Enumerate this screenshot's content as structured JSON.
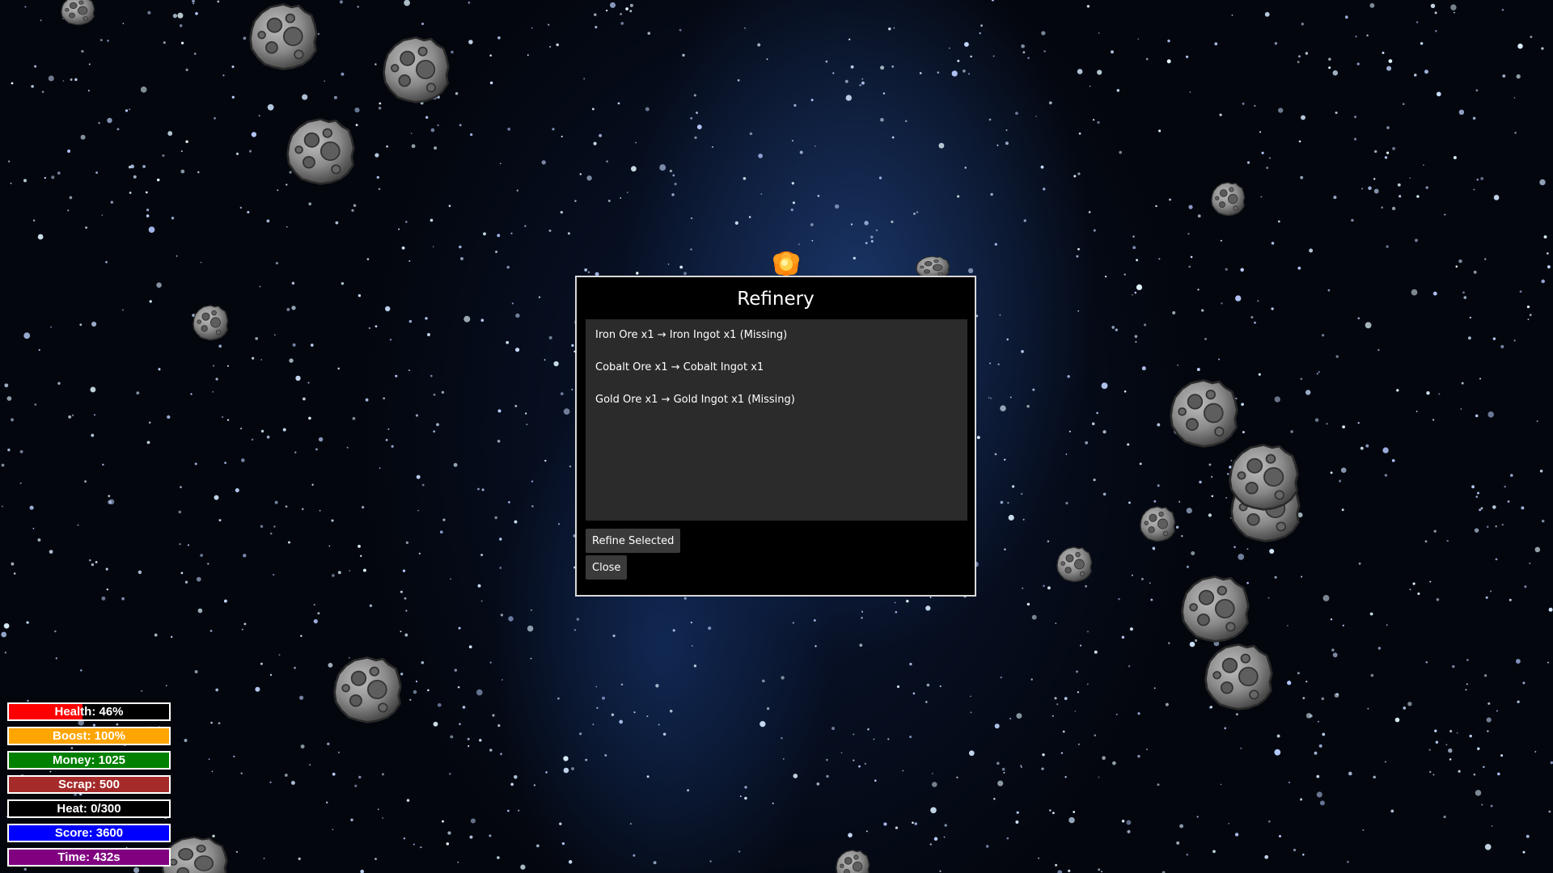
{
  "refinery": {
    "title": "Refinery",
    "recipes": [
      {
        "label": "Iron Ore x1 → Iron Ingot x1 (Missing)"
      },
      {
        "label": "Cobalt Ore x1 → Cobalt Ingot x1"
      },
      {
        "label": "Gold Ore x1 → Gold Ingot x1 (Missing)"
      }
    ],
    "refine_button": "Refine Selected",
    "close_button": "Close"
  },
  "hud": {
    "health": {
      "label": "Health: 46%",
      "level": 0.46,
      "color": "#ff0000"
    },
    "boost": {
      "label": "Boost: 100%",
      "level": 1.0,
      "color": "#ffa500"
    },
    "money": {
      "label": "Money: 1025",
      "level": 1.0,
      "color": "#008000"
    },
    "scrap": {
      "label": "Scrap: 500",
      "level": 1.0,
      "color": "#a52a2a"
    },
    "heat": {
      "label": "Heat: 0/300",
      "level": 0.0,
      "color": "#ff4500"
    },
    "score": {
      "label": "Score: 3600",
      "level": 1.0,
      "color": "#0000ff"
    },
    "time": {
      "label": "Time: 432s",
      "level": 1.0,
      "color": "#800080"
    }
  },
  "icons": {
    "asteroid": "asteroid-icon",
    "explosion": "explosion-icon"
  }
}
